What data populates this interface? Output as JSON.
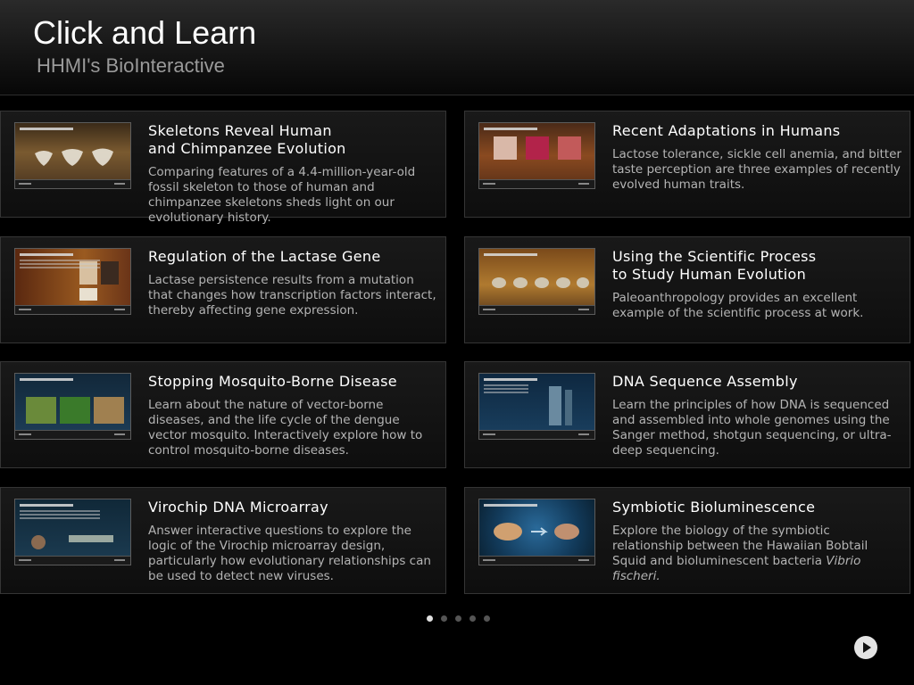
{
  "header": {
    "title": "Click and Learn",
    "subtitle": "HHMI's BioInteractive"
  },
  "cards": [
    {
      "title": "Skeletons Reveal Human\nand Chimpanzee Evolution",
      "description": "Comparing features of a 4.4-million-year-old fossil skeleton to those of human and chimpanzee skeletons sheds light on our evolutionary history.",
      "thumb_title": "Ardi's Ischium"
    },
    {
      "title": "Recent Adaptations in Humans",
      "description": "Lactose tolerance, sickle cell anemia, and bitter taste perception are three examples of recently evolved human traits.",
      "thumb_title": "Examples of Human Adaptations"
    },
    {
      "title": "Regulation of the Lactase Gene",
      "description": "Lactase persistence results from a mutation that changes how transcription factors interact, thereby affecting gene expression.",
      "thumb_title": "Lactose Intolerance and Gene Regulation"
    },
    {
      "title": "Using the Scientific Process\nto Study Human Evolution",
      "description": "Paleoanthropology provides an excellent example of the scientific process at work.",
      "thumb_title": "Human Evolution: Studying Remnants From the Past"
    },
    {
      "title": "Stopping Mosquito-Borne Disease",
      "description": "Learn about the nature of vector-borne diseases, and the life cycle of the dengue vector mosquito. Interactively explore how to control mosquito-borne diseases.",
      "thumb_title": "Disease Vectors"
    },
    {
      "title": "DNA Sequence Assembly",
      "description": "Learn the principles of how DNA is sequenced and assembled into whole genomes using the Sanger method, shotgun sequencing, or ultra-deep sequencing.",
      "thumb_title": "DNA Sequence Assembly"
    },
    {
      "title": "Virochip DNA Microarray",
      "description": "Answer interactive questions to explore the logic of the Virochip microarray design, particularly how evolutionary relationships can be used to detect new viruses.",
      "thumb_title": "Virochip DNA Microarray"
    },
    {
      "title": "Symbiotic Bioluminescence",
      "description": "Explore the biology of the symbiotic relationship between the Hawaiian Bobtail Squid and bioluminescent bacteria",
      "description_italic": "Vibrio fischeri.",
      "thumb_title": "Symbiotic Bioluminescence"
    }
  ],
  "pager": {
    "pages": 5,
    "current": 1
  },
  "icons": {
    "play": "play-icon"
  }
}
